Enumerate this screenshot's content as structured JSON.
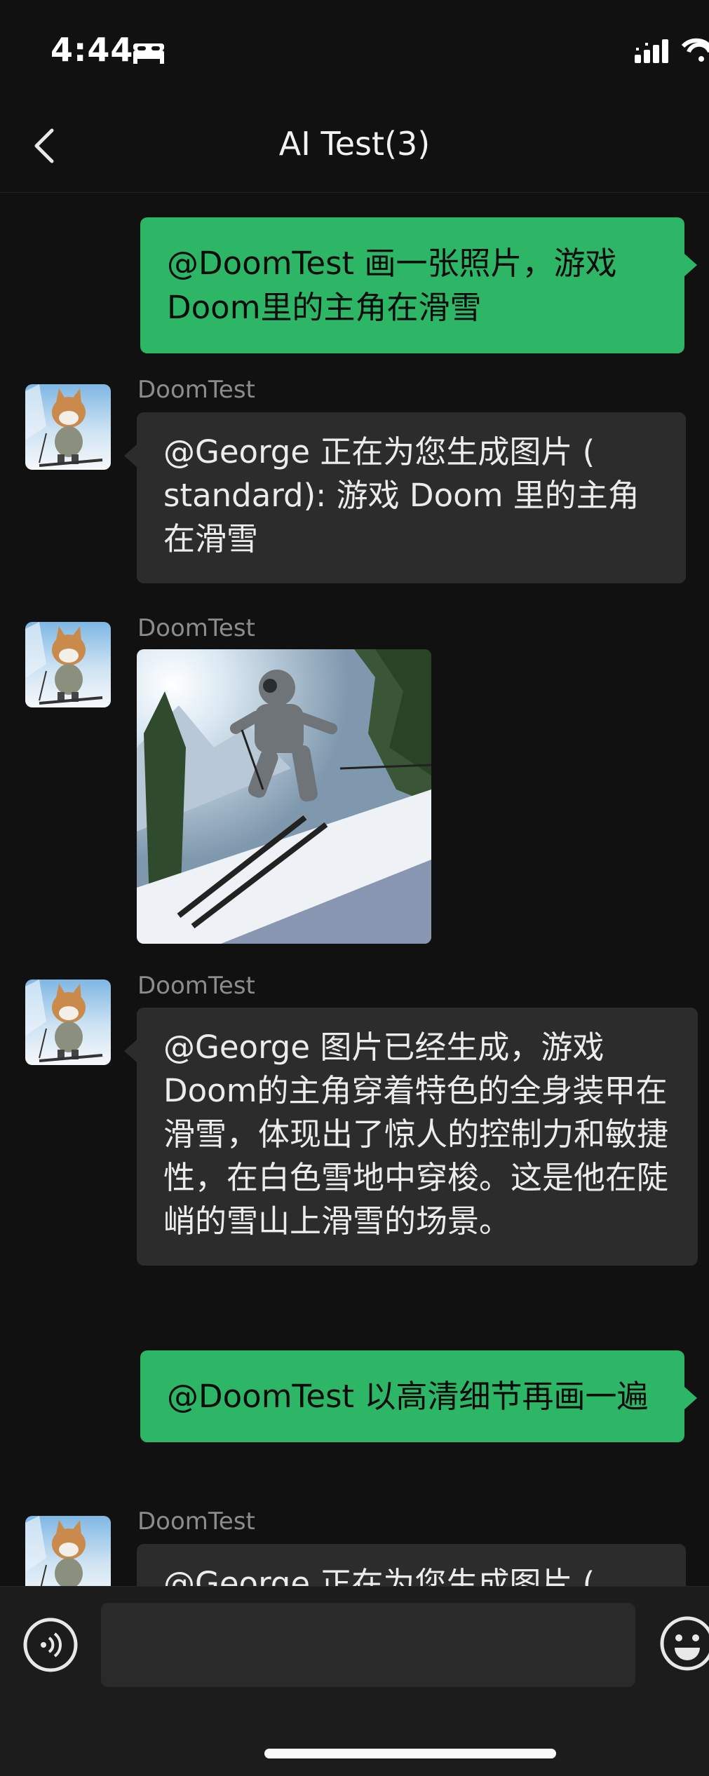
{
  "status_bar": {
    "time": "4:44",
    "icons": [
      "bed-icon",
      "signal-icon",
      "wifi-icon"
    ]
  },
  "nav": {
    "title": "AI Test(3)",
    "back_icon": "chevron-left-icon"
  },
  "colors": {
    "background": "#111111",
    "self_bubble": "#2db665",
    "other_bubble": "#2c2c2c",
    "sender_name": "#8c8c8c"
  },
  "messages": [
    {
      "from": "self",
      "text": "@DoomTest 画一张照片，游戏Doom里的主角在滑雪"
    },
    {
      "from": "DoomTest",
      "sender": "DoomTest",
      "text": " @George 正在为您生成图片 ( standard): 游戏 Doom 里的主角在滑雪"
    },
    {
      "from": "DoomTest",
      "sender": "DoomTest",
      "image": "generated-doom-skier-image"
    },
    {
      "from": "DoomTest",
      "sender": "DoomTest",
      "text": " @George 图片已经生成，游戏Doom的主角穿着特色的全身装甲在滑雪，体现出了惊人的控制力和敏捷性，在白色雪地中穿梭。这是他在陡峭的雪山上滑雪的场景。"
    },
    {
      "from": "self",
      "text": "@DoomTest 以高清细节再画一遍"
    },
    {
      "from": "DoomTest",
      "sender": "DoomTest",
      "text": " @George 正在为您生成图片 ("
    }
  ],
  "input_bar": {
    "voice_icon": "voice-icon",
    "input_value": "",
    "emoji_icon": "emoji-icon"
  }
}
